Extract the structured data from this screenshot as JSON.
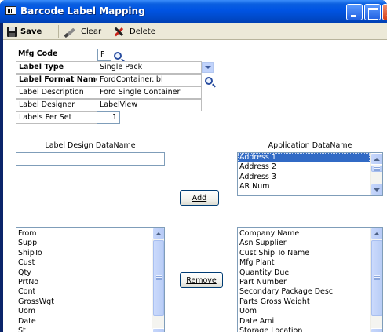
{
  "window": {
    "title": "Barcode Label Mapping"
  },
  "toolbar": {
    "save_label": "Save",
    "clear_label": "Clear",
    "delete_label": "Delete"
  },
  "form": {
    "mfg_code": {
      "label": "Mfg Code",
      "value": "F"
    },
    "label_type": {
      "label": "Label Type",
      "value": "Single Pack"
    },
    "label_format_name": {
      "label": "Label Format Name",
      "value": "FordContainer.lbl"
    },
    "label_description": {
      "label": "Label Description",
      "value": "Ford Single Container"
    },
    "label_designer": {
      "label": "Label Designer",
      "value": "LabelView"
    },
    "labels_per_set": {
      "label": "Labels Per Set",
      "value": "1"
    }
  },
  "mapping": {
    "left_caption": "Label Design DataName",
    "right_caption": "Application DataName",
    "left_input_value": "",
    "add_button": "Add",
    "remove_button": "Remove",
    "app_datanames": [
      "Address 1",
      "Address 2",
      "Address 3",
      "AR Num"
    ],
    "app_selected_index": 0,
    "label_fields": [
      "From",
      "Supp",
      "ShipTo",
      "Cust",
      "Qty",
      "PrtNo",
      "Cont",
      "GrossWgt",
      "Uom",
      "Date",
      "St"
    ],
    "app_fields": [
      "Company Name",
      "Asn Supplier",
      "Cust Ship To Name",
      "Mfg Plant",
      "Quantity Due",
      "Part Number",
      "Secondary Package Desc",
      "Parts Gross Weight",
      "Uom",
      "Date Ami",
      "Storage Location"
    ]
  },
  "icons": {
    "save": "save-icon",
    "clear": "clear-icon",
    "delete": "delete-icon",
    "lookup": "magnifier-icon",
    "dropdown": "chevron-down-icon"
  },
  "colors": {
    "titlebar": "#0054e3",
    "selection": "#316ac5",
    "toolbar": "#ece9d8"
  }
}
